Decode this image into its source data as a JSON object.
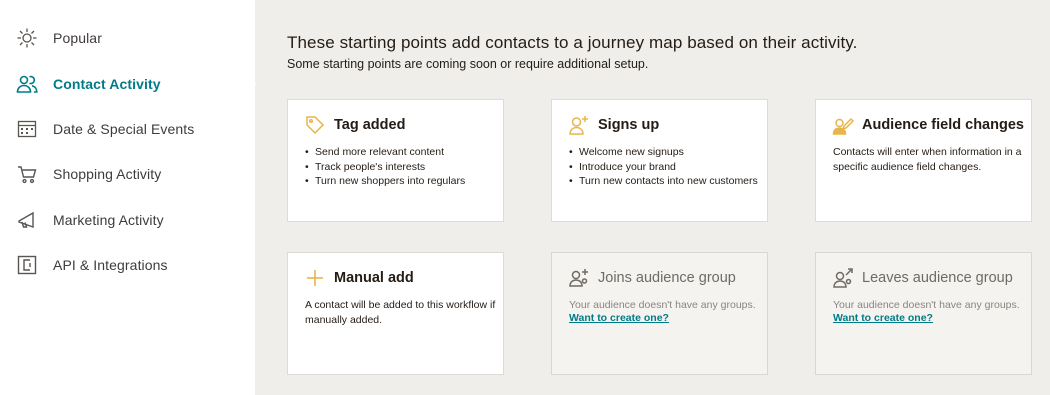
{
  "sidebar": {
    "items": [
      {
        "label": "Popular",
        "icon": "sparkle-icon",
        "active": false
      },
      {
        "label": "Contact Activity",
        "icon": "contacts-icon",
        "active": true
      },
      {
        "label": "Date & Special Events",
        "icon": "calendar-icon",
        "active": false
      },
      {
        "label": "Shopping Activity",
        "icon": "cart-icon",
        "active": false
      },
      {
        "label": "Marketing Activity",
        "icon": "megaphone-icon",
        "active": false
      },
      {
        "label": "API & Integrations",
        "icon": "api-icon",
        "active": false
      }
    ]
  },
  "main": {
    "headline": "These starting points add contacts to a journey map based on their activity.",
    "subline": "Some starting points are coming soon or require additional setup.",
    "cards": [
      {
        "title": "Tag added",
        "icon": "tag-icon",
        "bullets": [
          "Send more relevant content",
          "Track people's interests",
          "Turn new shoppers into regulars"
        ]
      },
      {
        "title": "Signs up",
        "icon": "user-plus-icon",
        "bullets": [
          "Welcome new signups",
          "Introduce your brand",
          "Turn new contacts into new customers"
        ]
      },
      {
        "title": "Audience field changes",
        "icon": "user-edit-icon",
        "description": "Contacts will enter when information in a specific audience field changes."
      },
      {
        "title": "Manual add",
        "icon": "plus-icon",
        "description": "A contact will be added to this workflow if manually added."
      },
      {
        "title": "Joins audience group",
        "icon": "group-join-icon",
        "description": "Your audience doesn't have any groups.",
        "link": "Want to create one?",
        "disabled": true
      },
      {
        "title": "Leaves audience group",
        "icon": "group-leave-icon",
        "description": "Your audience doesn't have any groups.",
        "link": "Want to create one?",
        "disabled": true
      }
    ]
  },
  "colors": {
    "accent_teal": "#007c89",
    "icon_gold": "#e8b54a",
    "background": "#efeeea",
    "text_dark": "#241c15"
  }
}
